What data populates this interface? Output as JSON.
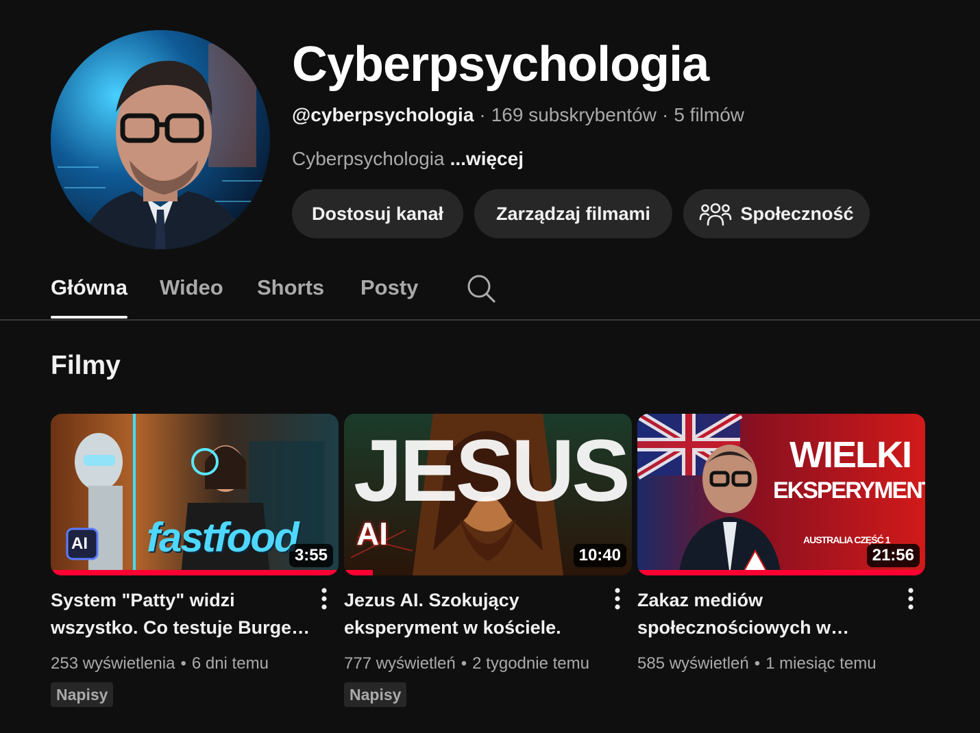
{
  "channel": {
    "name": "Cyberpsychologia",
    "handle": "@cyberpsychologia",
    "subscribers": "169 subskrybentów",
    "videos_count": "5 filmów",
    "description": "Cyberpsychologia",
    "more_label": "...więcej"
  },
  "actions": {
    "customize": "Dostosuj kanał",
    "manage": "Zarządzaj filmami",
    "community": "Społeczność"
  },
  "tabs": [
    {
      "label": "Główna",
      "active": true
    },
    {
      "label": "Wideo"
    },
    {
      "label": "Shorts"
    },
    {
      "label": "Posty"
    }
  ],
  "section": {
    "title": "Filmy"
  },
  "videos": [
    {
      "title": "System \"Patty\" widzi wszystko. Co testuje Burger King?",
      "duration": "3:55",
      "views": "253 wyświetlenia",
      "age": "6 dni temu",
      "badge": "Napisy",
      "thumb_text": "fastfood",
      "thumb_badge": "AI",
      "watched_fraction": 1.0
    },
    {
      "title": "Jezus AI. Szokujący eksperyment w kościele.",
      "duration": "10:40",
      "views": "777 wyświetleń",
      "age": "2 tygodnie temu",
      "badge": "Napisy",
      "thumb_text": "JESUS",
      "thumb_sub": "AI",
      "watched_fraction": 0.1
    },
    {
      "title": "Zakaz mediów społecznościowych w Australii",
      "duration": "21:56",
      "views": "585 wyświetleń",
      "age": "1 miesiąc temu",
      "thumb_line1": "WIELKI",
      "thumb_line2": "EKSPERYMENT",
      "thumb_small": "AUSTRALIA CZĘŚĆ 1",
      "watched_fraction": 1.0
    }
  ]
}
